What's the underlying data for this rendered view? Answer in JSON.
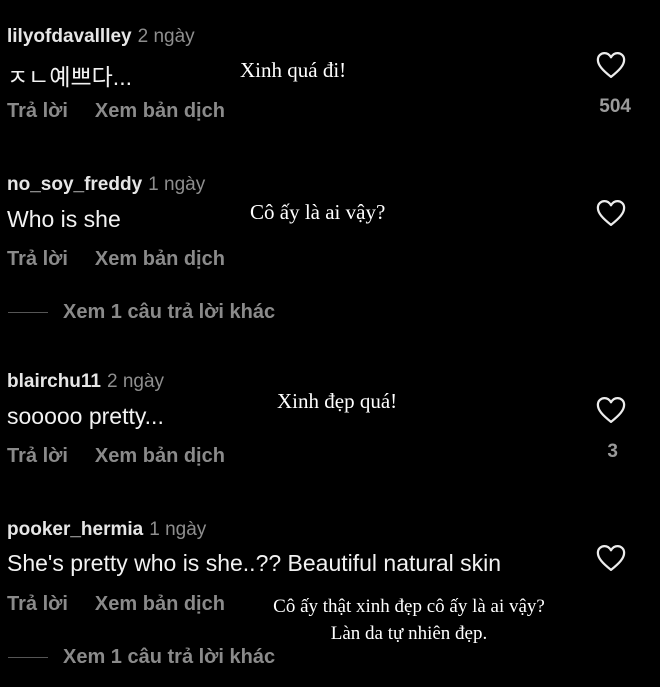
{
  "comments": [
    {
      "username": "lilyofdavallley",
      "time": "2 ngày",
      "text": "ㅈㄴ예쁘다...",
      "reply_label": "Trả lời",
      "translate_label": "Xem bản dịch",
      "likes": "504",
      "overlay": "Xinh quá đi!"
    },
    {
      "username": "no_soy_freddy",
      "time": "1 ngày",
      "text": "Who is she",
      "reply_label": "Trả lời",
      "translate_label": "Xem bản dịch",
      "likes": "",
      "overlay": "Cô ấy là ai vậy?",
      "view_more": "Xem 1 câu trả lời khác"
    },
    {
      "username": "blairchu11",
      "time": "2 ngày",
      "text": "sooooo pretty...",
      "reply_label": "Trả lời",
      "translate_label": "Xem bản dịch",
      "likes": "3",
      "overlay": "Xinh đẹp quá!"
    },
    {
      "username": "pooker_hermia",
      "time": "1 ngày",
      "text": "She's pretty who is she..?? Beautiful natural skin",
      "reply_label": "Trả lời",
      "translate_label": "Xem bản dịch",
      "likes": "",
      "overlay_line1": "Cô ấy thật xinh đẹp cô ấy là ai vậy?",
      "overlay_line2": "Làn da tự nhiên đẹp.",
      "view_more": "Xem 1 câu trả lời khác"
    }
  ],
  "icons": {
    "like": "heart-outline-icon"
  }
}
